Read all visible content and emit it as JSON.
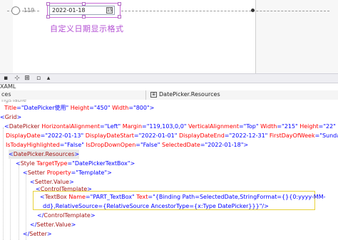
{
  "designer": {
    "measure_label": "119",
    "datepicker_value": "2022-01-18",
    "calendar_button": "15",
    "caption": "自定义日期显示格式"
  },
  "toolbar": {
    "icons": [
      "toolbox-icon",
      "pointer-icon",
      "pan-icon",
      "split-icon",
      "collapse-icon"
    ]
  },
  "xaml_label": "XAML",
  "breadcrumb": {
    "left": "ces",
    "right": "DatePicker.Resources"
  },
  "code": {
    "line0": "ngsTable",
    "line1": {
      "attr1": "Title",
      "val1": "\"DatePicker使用\"",
      "attr2": "Height",
      "val2": "\"450\"",
      "attr3": "Width",
      "val3": "\"800\"",
      "end": ">"
    },
    "line2": {
      "open": "<",
      "tag": "Grid",
      "close": ">"
    },
    "line3": {
      "open": "<",
      "tag": "DatePicker",
      "a1": "HorizontalAlignment",
      "v1": "\"Left\"",
      "a2": "Margin",
      "v2": "\"119,103,0,0\"",
      "a3": "VerticalAlignment",
      "v3": "\"Top\"",
      "a4": "Width",
      "v4": "\"215\"",
      "a5": "Height",
      "v5": "\"22\""
    },
    "line4": {
      "a1": "DisplayDate",
      "v1": "\"2022-01-13\"",
      "a2": "DisplayDateStart",
      "v2": "\"2022-01-01\"",
      "a3": "DisplayDateEnd",
      "v3": "\"2022-12-31\"",
      "a4": "FirstDayOfWeek",
      "v4": "\"Sunday\""
    },
    "line5": {
      "a1": "IsTodayHighlighted",
      "v1": "\"False\"",
      "a2": "IsDropDownOpen",
      "v2": "\"False\"",
      "a3": "SelectedDate",
      "v3": "\"2022-01-18\"",
      "end": ">"
    },
    "line6": {
      "open": "<",
      "tag": "DatePicker.Resources",
      "close": ">"
    },
    "line7": {
      "open": "<",
      "tag": "Style",
      "a1": "TargetType",
      "v1": "\"DatePickerTextBox\"",
      "close": ">"
    },
    "line8": {
      "open": "<",
      "tag": "Setter",
      "a1": "Property",
      "v1": "\"Template\"",
      "close": ">"
    },
    "line9": {
      "open": "<",
      "tag": "Setter.Value",
      "close": ">"
    },
    "line10": {
      "open": "<",
      "tag": "ControlTemplate",
      "close": ">"
    },
    "line11": {
      "open": "<",
      "tag": "TextBox",
      "a1": "Name",
      "v1": "\"PART_TextBox\"",
      "a2": "Text",
      "v2": "\"{Binding Path=SelectedDate,StringFormat={}{0:yyyy-MM-"
    },
    "line12": {
      "v1": "dd},RelativeSource={RelativeSource AncestorType={x:Type DatePicker}}}\"",
      "close": "/>"
    },
    "line13": {
      "open": "</",
      "tag": "ControlTemplate",
      "close": ">"
    },
    "line14": {
      "open": "</",
      "tag": "Setter.Value",
      "close": ">"
    },
    "line15": {
      "open": "</",
      "tag": "Setter",
      "close": ">"
    }
  }
}
